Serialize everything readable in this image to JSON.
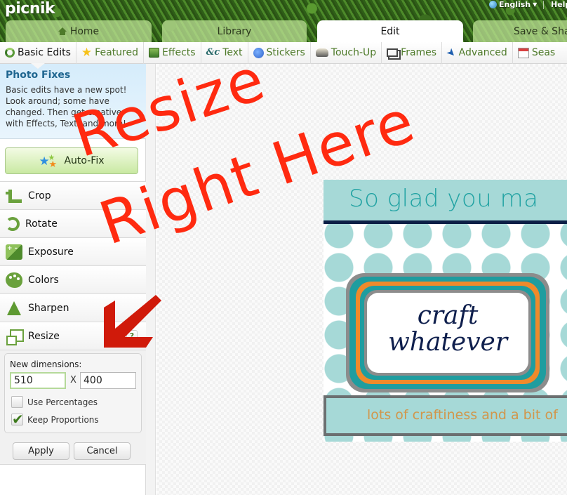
{
  "app": {
    "logo": "picnik",
    "language": "English",
    "help": "Help"
  },
  "main_tabs": [
    {
      "label": "Home",
      "icon": "home-icon",
      "active": false
    },
    {
      "label": "Library",
      "active": false
    },
    {
      "label": "Edit",
      "active": true
    },
    {
      "label": "Save & Sha",
      "active": false
    }
  ],
  "sub_tabs": [
    {
      "label": "Basic Edits",
      "icon": "basic-edits-icon",
      "active": true
    },
    {
      "label": "Featured",
      "icon": "star-icon"
    },
    {
      "label": "Effects",
      "icon": "effects-icon"
    },
    {
      "label": "Text",
      "icon": "text-icon"
    },
    {
      "label": "Stickers",
      "icon": "sticker-icon"
    },
    {
      "label": "Touch-Up",
      "icon": "touch-up-icon"
    },
    {
      "label": "Frames",
      "icon": "frames-icon"
    },
    {
      "label": "Advanced",
      "icon": "rocket-icon"
    },
    {
      "label": "Seas",
      "icon": "calendar-icon"
    }
  ],
  "sidebar": {
    "tip_title": "Photo Fixes",
    "tip_body": "Basic edits have a new spot! Look around; some have changed. Then get creative with Effects, Text, and more!",
    "autofix_label": "Auto-Fix",
    "tools": [
      {
        "label": "Crop",
        "icon": "crop-icon"
      },
      {
        "label": "Rotate",
        "icon": "rotate-icon"
      },
      {
        "label": "Exposure",
        "icon": "exposure-icon"
      },
      {
        "label": "Colors",
        "icon": "palette-icon"
      },
      {
        "label": "Sharpen",
        "icon": "sharpen-icon"
      },
      {
        "label": "Resize",
        "icon": "resize-icon",
        "expanded": true
      }
    ],
    "help_glyph": "?",
    "resize": {
      "dims_label": "New dimensions:",
      "width": "510",
      "separator": "X",
      "height": "400",
      "use_percentages_label": "Use Percentages",
      "use_percentages": false,
      "keep_proportions_label": "Keep Proportions",
      "keep_proportions": true,
      "apply_label": "Apply",
      "cancel_label": "Cancel"
    }
  },
  "canvas": {
    "photo_top_text": "So glad you ma",
    "photo_center_line1": "craft",
    "photo_center_line2": "whatever",
    "photo_banner_text": "lots of craftiness and a bit of"
  },
  "annotation": {
    "line1": "Resize",
    "line2": "Right Here",
    "color": "#ff2a10",
    "arrow_color": "#d01a0a"
  }
}
